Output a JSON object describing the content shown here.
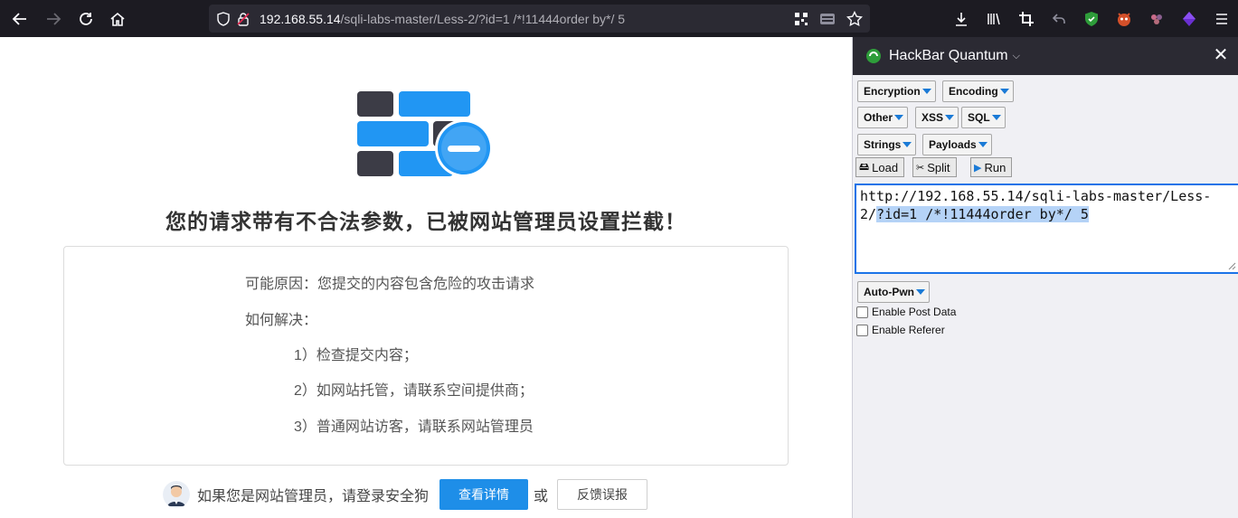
{
  "browser": {
    "url_host": "192.168.55.14",
    "url_path": "/sqli-labs-master/Less-2/?id=1 /*!11444order by*/ 5"
  },
  "page": {
    "heading": "您的请求带有不合法参数，已被网站管理员设置拦截！",
    "reason_label": "可能原因：您提交的内容包含危险的攻击请求",
    "solve_label": "如何解决：",
    "solution_1": "1）检查提交内容；",
    "solution_2": "2）如网站托管，请联系空间提供商；",
    "solution_3": "3）普通网站访客，请联系网站管理员",
    "admin_text": "如果您是网站管理员，请登录安全狗",
    "details_button": "查看详情",
    "or_text": "或",
    "feedback_button": "反馈误报"
  },
  "hackbar": {
    "title": "HackBar Quantum",
    "menus": {
      "encryption": "Encryption",
      "encoding": "Encoding",
      "other": "Other",
      "xss": "XSS",
      "sql": "SQL",
      "strings": "Strings",
      "payloads": "Payloads",
      "autopwn": "Auto-Pwn"
    },
    "actions": {
      "load": "Load",
      "split": "Split",
      "run": "Run"
    },
    "url_unselected": "http://192.168.55.14/sqli-labs-master/Less-2/",
    "url_selected": "?id=1 /*!11444order by*/ 5",
    "enable_post": "Enable Post Data",
    "enable_referer": "Enable Referer"
  },
  "colors": {
    "toolbar_bg": "#1c1b22",
    "accent_blue": "#1e8ee8",
    "brick_dark": "#3c3c46",
    "brick_blue": "#2196f3"
  }
}
